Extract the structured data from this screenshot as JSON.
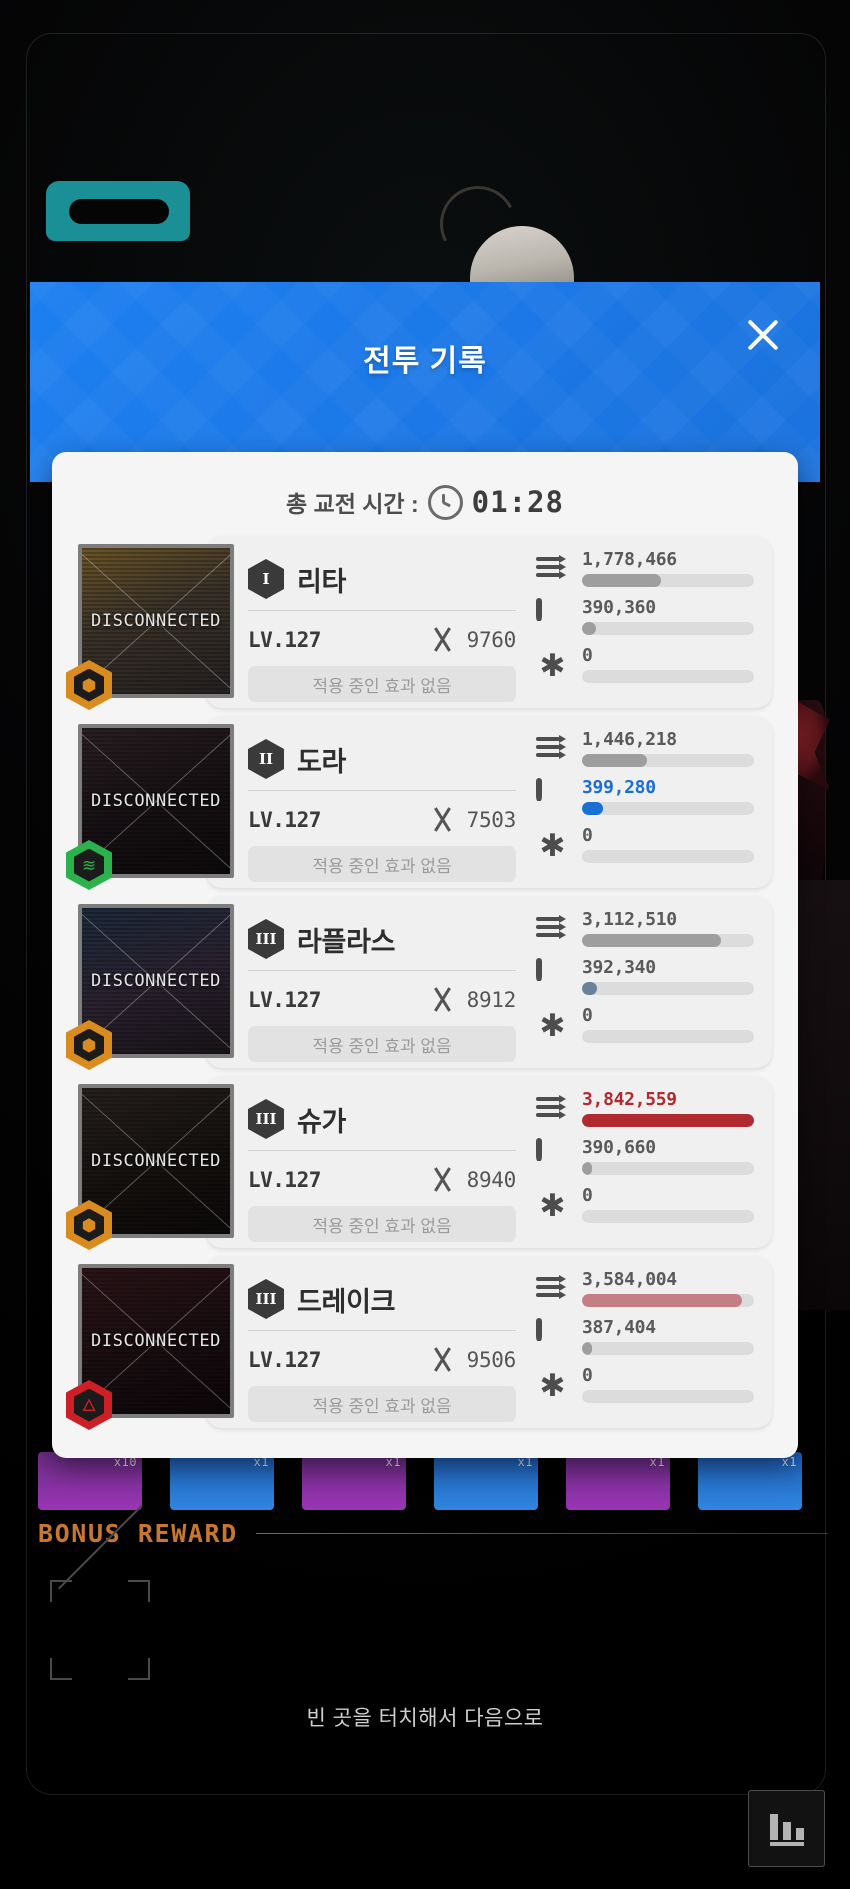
{
  "background": {
    "bonus_reward_label": "BONUS REWARD",
    "touch_hint": "빈 곳을 터치해서 다음으로",
    "chart_button_icon": "bar-chart-icon",
    "item_slots": [
      {
        "qty": "x10",
        "color": "#9b35b5"
      },
      {
        "qty": "x1",
        "color": "#2f86e0"
      },
      {
        "qty": "x1",
        "color": "#9b35b5"
      },
      {
        "qty": "x1",
        "color": "#2f86e0"
      },
      {
        "qty": "x1",
        "color": "#9b35b5"
      },
      {
        "qty": "x1",
        "color": "#2f86e0"
      }
    ]
  },
  "modal": {
    "title": "전투 기록",
    "close_icon": "close-icon",
    "accent_color": "#1a72dd",
    "time": {
      "label": "총 교전 시간 :",
      "clock_icon": "clock-icon",
      "value": "01:28"
    },
    "stat_icons": {
      "damage": "damage-arrows-icon",
      "shield": "shield-icon",
      "support": "asterisk-icon"
    },
    "buff_empty_text": "적용 중인 효과 없음",
    "disconnected_label": "DISCONNECTED",
    "sword_icon": "crossed-swords-icon",
    "players": [
      {
        "rank": "I",
        "name": "리타",
        "level": "LV.127",
        "combat_power": "9760",
        "buff_text": "적용 중인 효과 없음",
        "status": "DISCONNECTED",
        "element_badge": "honeycomb-icon",
        "element_color": "#d98b1f",
        "avatar_tint": "linear-gradient(160deg,#6b5528 0%,#3a3229 45%,#242021 100%)",
        "stats": [
          {
            "key": "damage",
            "value": "1,778,466",
            "pct": 46,
            "color": "#9e9e9e",
            "highlight": false
          },
          {
            "key": "shield",
            "value": "390,360",
            "pct": 8,
            "color": "#9e9e9e",
            "highlight": false
          },
          {
            "key": "support",
            "value": "0",
            "pct": 0,
            "color": "#9e9e9e",
            "highlight": false
          }
        ]
      },
      {
        "rank": "II",
        "name": "도라",
        "level": "LV.127",
        "combat_power": "7503",
        "buff_text": "적용 중인 효과 없음",
        "status": "DISCONNECTED",
        "element_badge": "wind-icon",
        "element_color": "#2bb24c",
        "avatar_tint": "linear-gradient(160deg,#2a2024 0%,#171114 50%,#0d0a0c 100%)",
        "stats": [
          {
            "key": "damage",
            "value": "1,446,218",
            "pct": 38,
            "color": "#9e9e9e",
            "highlight": false
          },
          {
            "key": "shield",
            "value": "399,280",
            "pct": 12,
            "color": "#1a6fd4",
            "highlight": true
          },
          {
            "key": "support",
            "value": "0",
            "pct": 0,
            "color": "#9e9e9e",
            "highlight": false
          }
        ]
      },
      {
        "rank": "III",
        "name": "라플라스",
        "level": "LV.127",
        "combat_power": "8912",
        "buff_text": "적용 중인 효과 없음",
        "status": "DISCONNECTED",
        "element_badge": "honeycomb-icon",
        "element_color": "#d98b1f",
        "avatar_tint": "linear-gradient(160deg,#1d2a3c 0%,#2a2230 50%,#191418 100%)",
        "stats": [
          {
            "key": "damage",
            "value": "3,112,510",
            "pct": 81,
            "color": "#9e9e9e",
            "highlight": false
          },
          {
            "key": "shield",
            "value": "392,340",
            "pct": 9,
            "color": "#6b8099",
            "highlight": false
          },
          {
            "key": "support",
            "value": "0",
            "pct": 0,
            "color": "#9e9e9e",
            "highlight": false
          }
        ]
      },
      {
        "rank": "III",
        "name": "슈가",
        "level": "LV.127",
        "combat_power": "8940",
        "buff_text": "적용 중인 효과 없음",
        "status": "DISCONNECTED",
        "element_badge": "honeycomb-icon",
        "element_color": "#d98b1f",
        "avatar_tint": "linear-gradient(160deg,#26211f 0%,#15110f 55%,#0b0908 100%)",
        "stats": [
          {
            "key": "damage",
            "value": "3,842,559",
            "pct": 100,
            "color": "#b02a30",
            "highlight": true
          },
          {
            "key": "shield",
            "value": "390,660",
            "pct": 6,
            "color": "#9e9e9e",
            "highlight": false
          },
          {
            "key": "support",
            "value": "0",
            "pct": 0,
            "color": "#9e9e9e",
            "highlight": false
          }
        ]
      },
      {
        "rank": "III",
        "name": "드레이크",
        "level": "LV.127",
        "combat_power": "9506",
        "buff_text": "적용 중인 효과 없음",
        "status": "DISCONNECTED",
        "element_badge": "flame-icon",
        "element_color": "#cc2026",
        "avatar_tint": "linear-gradient(160deg,#2b1418 0%,#190d10 55%,#0c0608 100%)",
        "stats": [
          {
            "key": "damage",
            "value": "3,584,004",
            "pct": 93,
            "color": "#c37f84",
            "highlight": false
          },
          {
            "key": "shield",
            "value": "387,404",
            "pct": 6,
            "color": "#9e9e9e",
            "highlight": false
          },
          {
            "key": "support",
            "value": "0",
            "pct": 0,
            "color": "#9e9e9e",
            "highlight": false
          }
        ]
      }
    ]
  }
}
